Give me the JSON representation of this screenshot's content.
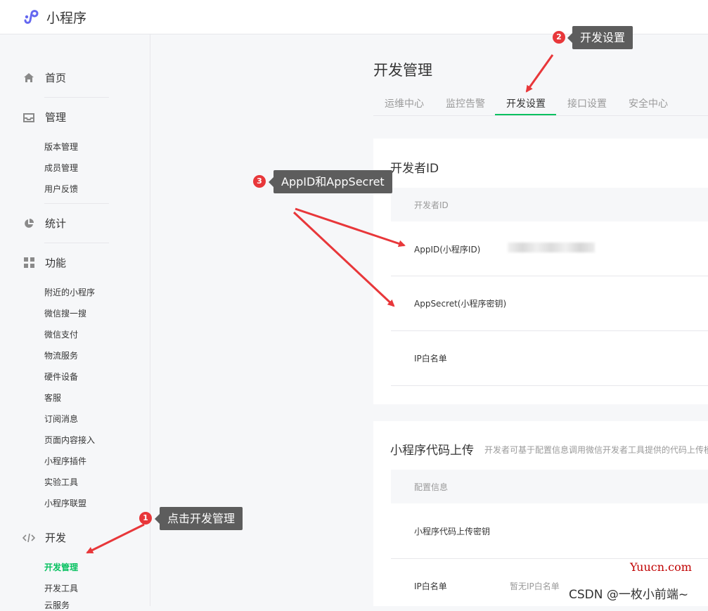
{
  "app": {
    "title": "小程序"
  },
  "sidebar": {
    "groups": [
      {
        "label": "首页",
        "icon": "home-icon"
      },
      {
        "label": "管理",
        "icon": "inbox-icon",
        "items": [
          "版本管理",
          "成员管理",
          "用户反馈"
        ]
      },
      {
        "label": "统计",
        "icon": "pie-chart-icon"
      },
      {
        "label": "功能",
        "icon": "grid-icon",
        "items": [
          "附近的小程序",
          "微信搜一搜",
          "微信支付",
          "物流服务",
          "硬件设备",
          "客服",
          "订阅消息",
          "页面内容接入",
          "小程序插件",
          "实验工具",
          "小程序联盟"
        ]
      },
      {
        "label": "开发",
        "icon": "code-icon",
        "items": [
          "开发管理",
          "开发工具",
          "云服务"
        ]
      }
    ],
    "active_item": "开发管理"
  },
  "main": {
    "title": "开发管理",
    "tabs": [
      "运维中心",
      "监控告警",
      "开发设置",
      "接口设置",
      "安全中心"
    ],
    "active_tab": "开发设置",
    "developer_card": {
      "title": "开发者ID",
      "table_header": "开发者ID",
      "rows": [
        {
          "label": "AppID(小程序ID)"
        },
        {
          "label": "AppSecret(小程序密钥)"
        },
        {
          "label": "IP白名单"
        }
      ]
    },
    "upload_card": {
      "title": "小程序代码上传",
      "desc": "开发者可基于配置信息调用微信开发者工具提供的代码上传模块",
      "table_header": "配置信息",
      "rows": [
        {
          "label": "小程序代码上传密钥"
        },
        {
          "label": "IP白名单",
          "value": "暂无IP白名单"
        }
      ]
    }
  },
  "annotations": [
    {
      "number": "1",
      "text": "点击开发管理"
    },
    {
      "number": "2",
      "text": "开发设置"
    },
    {
      "number": "3",
      "text": "AppID和AppSecret"
    }
  ],
  "watermarks": {
    "site": "Yuucn.com",
    "author": "CSDN @一枚小前端~"
  },
  "colors": {
    "accent": "#07c160",
    "annotation_red": "#e8373a",
    "callout_bg": "#5d5d5d"
  }
}
